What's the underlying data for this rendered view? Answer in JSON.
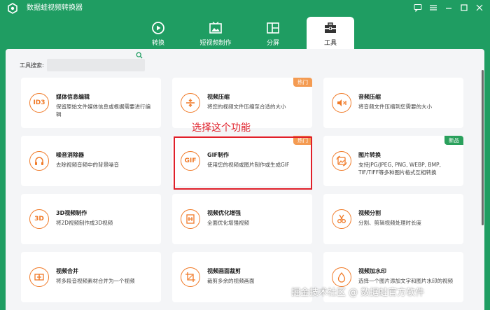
{
  "app": {
    "title": "数据蛙视频转换器"
  },
  "nav": {
    "tabs": [
      {
        "label": "转换",
        "icon": "convert-icon"
      },
      {
        "label": "短视频制作",
        "icon": "short-video-icon"
      },
      {
        "label": "分屏",
        "icon": "split-screen-icon"
      },
      {
        "label": "工具",
        "icon": "toolbox-icon",
        "active": true
      }
    ]
  },
  "search": {
    "label": "工具搜索:",
    "placeholder": ""
  },
  "cards": [
    {
      "title": "媒体信息编辑",
      "desc": "保留原始文件媒体信息或根据需要进行编辑",
      "icon": "ID3"
    },
    {
      "title": "视频压缩",
      "desc": "将您的视频文件压缩至合适的大小",
      "icon": "compress-icon",
      "badge": "热门"
    },
    {
      "title": "音频压缩",
      "desc": "将音频文件压缩到您需要的大小",
      "icon": "audio-compress-icon"
    },
    {
      "title": "噪音消除器",
      "desc": "去除视频音频中的背景噪音",
      "icon": "headphones-icon"
    },
    {
      "title": "GIF制作",
      "desc": "使用您的视频或图片制作或生成GIF",
      "icon": "GIF",
      "badge": "热门"
    },
    {
      "title": "图片转换",
      "desc": "支持JPG/JPEG, PNG, WEBP, BMP, TIF/TIFF等多种图片格式互相转换",
      "icon": "image-convert-icon",
      "badge": "新品"
    },
    {
      "title": "3D视频制作",
      "desc": "将2D视频制作成3D视频",
      "icon": "3D"
    },
    {
      "title": "视频优化增强",
      "desc": "全面优化增强视频",
      "icon": "enhance-icon"
    },
    {
      "title": "视频分割",
      "desc": "分割、剪辑视频处理时长度",
      "icon": "scissors-icon"
    },
    {
      "title": "视频合并",
      "desc": "将多段音视频素材合并为一个视频",
      "icon": "merge-icon"
    },
    {
      "title": "视频画面裁剪",
      "desc": "裁剪多余的视频画面",
      "icon": "crop-icon"
    },
    {
      "title": "视频加水印",
      "desc": "选择一个图片添加文字和图片水印的视频",
      "icon": "watermark-icon"
    }
  ],
  "annotation": {
    "text": "选择这个功能"
  },
  "watermark": {
    "text": "掘金技术社区 @ 数据蛙官方软件"
  },
  "colors": {
    "brand": "#1f9d62",
    "accent": "#f07a28",
    "hot": "#f49b52",
    "new": "#2aa05c",
    "highlight": "#e0202a"
  }
}
